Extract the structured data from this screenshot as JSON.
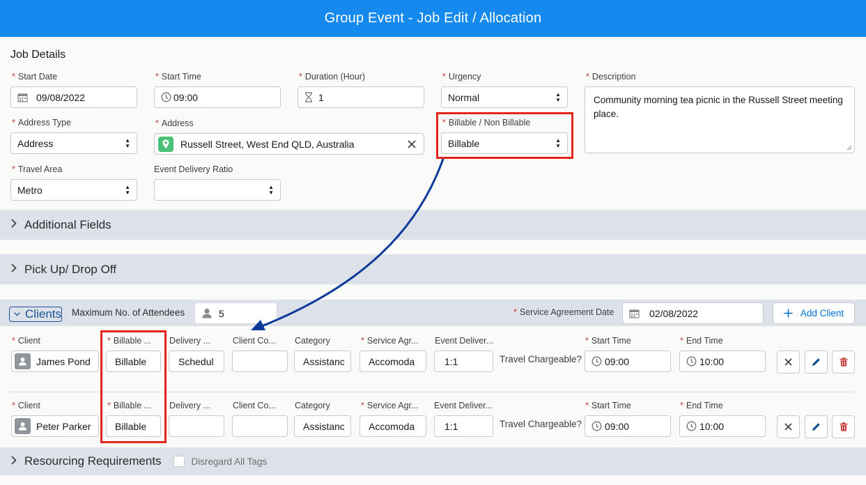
{
  "header": {
    "title": "Group Event - Job Edit / Allocation"
  },
  "job_details": {
    "title": "Job Details",
    "start_date": {
      "label": "Start Date",
      "value": "09/08/2022"
    },
    "start_time": {
      "label": "Start Time",
      "value": "09:00"
    },
    "duration": {
      "label": "Duration (Hour)",
      "value": "1"
    },
    "urgency": {
      "label": "Urgency",
      "value": "Normal"
    },
    "description": {
      "label": "Description",
      "value": "Community morning tea picnic in the Russell Street meeting place."
    },
    "address_type": {
      "label": "Address Type",
      "value": "Address"
    },
    "address": {
      "label": "Address",
      "value": "Russell Street, West End QLD, Australia"
    },
    "billable": {
      "label": "Billable / Non Billable",
      "value": "Billable"
    },
    "travel_area": {
      "label": "Travel Area",
      "value": "Metro"
    },
    "event_delivery_ratio": {
      "label": "Event Delivery Ratio",
      "value": ""
    }
  },
  "sections": {
    "additional_fields": "Additional Fields",
    "pickup_dropoff": "Pick Up/ Drop Off",
    "resourcing": "Resourcing Requirements",
    "disregard_tags": "Disregard All Tags"
  },
  "clients": {
    "title": "Clients",
    "max_attendees_label": "Maximum No. of Attendees",
    "max_attendees_value": "5",
    "service_agreement_date_label": "Service Agreement Date",
    "service_agreement_date_value": "02/08/2022",
    "add_client_label": "Add Client",
    "columns": {
      "client": "Client",
      "billable": "Billable ...",
      "delivery": "Delivery ...",
      "client_co": "Client Co...",
      "category": "Category",
      "service_agr": "Service Agr...",
      "event_deliver": "Event Deliver...",
      "start_time": "Start Time",
      "end_time": "End Time"
    },
    "travel_chargeable_label": "Travel Chargeable?",
    "rows": [
      {
        "client": "James Pond",
        "billable": "Billable",
        "delivery": "Schedul",
        "client_co": "",
        "category": "Assistance",
        "service_agr": "Accomoda",
        "event_deliver": "1:1",
        "start_time": "09:00",
        "end_time": "10:00"
      },
      {
        "client": "Peter Parker",
        "billable": "Billable",
        "delivery": "",
        "client_co": "",
        "category": "Assistance",
        "service_agr": "Accomoda",
        "event_deliver": "1:1",
        "start_time": "09:00",
        "end_time": "10:00"
      }
    ]
  },
  "colors": {
    "header_bg": "#1589ee",
    "highlight": "#e3261c",
    "arrow": "#0b3a9a",
    "band_bg": "#dde2ea"
  }
}
